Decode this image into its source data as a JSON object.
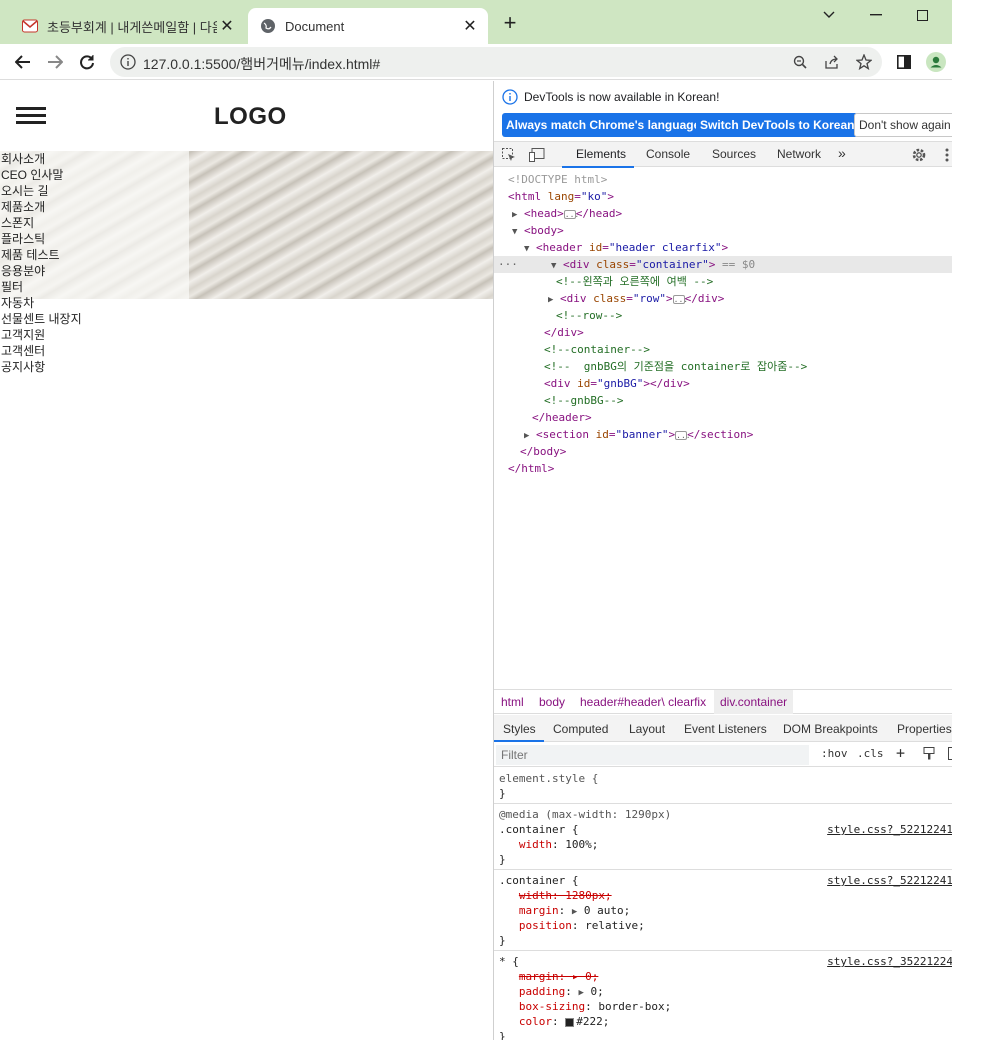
{
  "browser": {
    "tabs": [
      {
        "title": "초등부회계 | 내게쓴메일함 | 다음",
        "active": false,
        "icon": "mail-icon"
      },
      {
        "title": "Document",
        "active": true,
        "icon": "globe-icon"
      }
    ],
    "new_tab": "+",
    "url": "127.0.0.1:5500/햄버거메뉴/index.html#"
  },
  "page": {
    "logo": "LOGO",
    "menu": [
      "회사소개",
      "CEO 인사말",
      "오시는 길",
      "제품소개",
      "스폰지",
      "플라스틱",
      "제품 테스트",
      "응용분야",
      "필터",
      "자동차",
      "선물센트 내장지",
      "고객지원",
      "고객센터",
      "공지사항"
    ]
  },
  "devtools": {
    "notice": "DevTools is now available in Korean!",
    "buttons": {
      "match": "Always match Chrome's language",
      "switch": "Switch DevTools to Korean",
      "dismiss": "Don't show again"
    },
    "tabs": [
      "Elements",
      "Console",
      "Sources",
      "Network"
    ],
    "active_tab": "Elements",
    "more": "»",
    "dom": {
      "doctype": "<!DOCTYPE html>",
      "html_open": "<html",
      "html_lang_attr": "lang",
      "html_lang_val": "\"ko\"",
      "head": "<head>",
      "head_close": "</head>",
      "body_open": "<body>",
      "header_open": "<header",
      "header_id_attr": "id",
      "header_id_val": "\"header clearfix\"",
      "div_open": "<div",
      "div_class_attr": "class",
      "div_class_val": "\"container\"",
      "eq0": "== $0",
      "comment1": "<!--왼쪽과 오른쪽에 여백 -->",
      "row_open": "<div",
      "row_class_attr": "class",
      "row_class_val": "\"row\"",
      "row_close": "</div>",
      "comment_row": "<!--row-->",
      "div_close": "</div>",
      "comment_container": "<!--container-->",
      "comment_gnb": "<!--  gnbBG의 기준점을 container로 잡아줌-->",
      "gnb_open": "<div",
      "gnb_id_attr": "id",
      "gnb_id_val": "\"gnbBG\"",
      "gnb_close": "</div>",
      "comment_gnbbg": "<!--gnbBG-->",
      "header_close": "</header>",
      "section_open": "<section",
      "section_id_attr": "id",
      "section_id_val": "\"banner\"",
      "section_close": "</section>",
      "body_close": "</body>",
      "html_close": "</html>",
      "dots": "..."
    },
    "breadcrumbs": [
      "html",
      "body",
      "header#header\\ clearfix",
      "div.container"
    ],
    "style_tabs": [
      "Styles",
      "Computed",
      "Layout",
      "Event Listeners",
      "DOM Breakpoints",
      "Properties"
    ],
    "filter_placeholder": "Filter",
    "filter_tools": {
      "hov": ":hov",
      "cls": ".cls"
    },
    "rules": {
      "element_style": "element.style {",
      "close": "}",
      "media": "@media (max-width: 1290px)",
      "container": ".container {",
      "source1": "style.css?_52212241",
      "width": "width",
      "width_val": "100%;",
      "source2": "style.css?_52212241",
      "width_old": "width: 1280px;",
      "margin": "margin",
      "margin_val": "0 auto;",
      "position": "position",
      "position_val": "relative;",
      "universal": "* {",
      "source3": "style.css?_35221224",
      "margin_old": "margin: ▸ 0;",
      "padding": "padding",
      "padding_val": "0;",
      "box_sizing": "box-sizing",
      "box_sizing_val": "border-box;",
      "color": "color",
      "color_val": "#222;"
    }
  }
}
